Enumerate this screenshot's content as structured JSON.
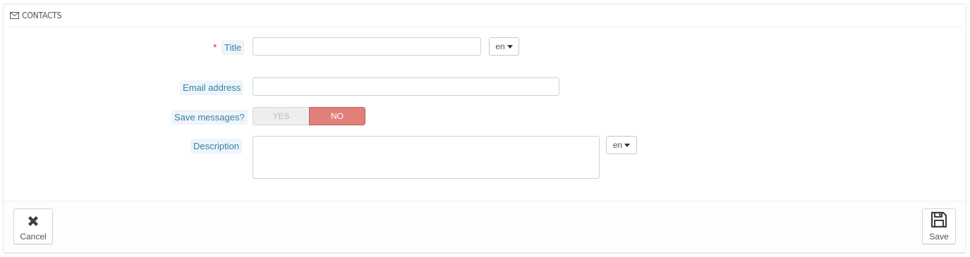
{
  "panel": {
    "heading": "CONTACTS",
    "heading_icon": "envelope-icon"
  },
  "form": {
    "title": {
      "label": "Title",
      "required_mark": "*",
      "value": "",
      "lang": "en"
    },
    "email": {
      "label": "Email address",
      "value": ""
    },
    "save_messages": {
      "label": "Save messages?",
      "yes_label": "YES",
      "no_label": "NO",
      "selected": "NO"
    },
    "description": {
      "label": "Description",
      "value": "",
      "lang": "en"
    }
  },
  "footer": {
    "cancel_label": "Cancel",
    "cancel_icon": "close-icon",
    "save_label": "Save",
    "save_icon": "floppy-disk-icon"
  },
  "colors": {
    "label_text": "#3a7fa8",
    "label_bg": "#eef5fa",
    "required": "#e0343f",
    "no_active": "#e08079"
  }
}
